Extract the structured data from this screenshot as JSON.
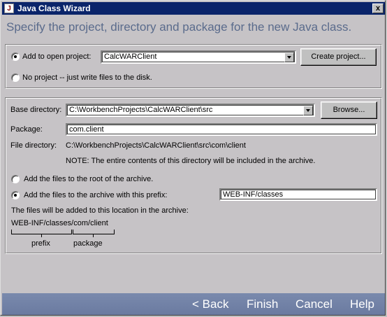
{
  "window": {
    "title": "Java Class Wizard",
    "close_label": "x"
  },
  "heading": "Specify the project, directory and package for the new Java class.",
  "project": {
    "add_label": "Add to open project:",
    "project_value": "CalcWARClient",
    "create_button": "Create project...",
    "no_project_label": "No project -- just write files to the disk."
  },
  "location": {
    "base_dir_label": "Base directory:",
    "base_dir_value": "C:\\WorkbenchProjects\\CalcWARClient\\src",
    "browse_button": "Browse...",
    "package_label": "Package:",
    "package_value": "com.client",
    "file_dir_label": "File directory:",
    "file_dir_value": "C:\\WorkbenchProjects\\CalcWARClient\\src\\com\\client",
    "note": "NOTE: The entire contents of this directory will be included in the archive.",
    "root_label": "Add the files to the root of the archive.",
    "prefix_label": "Add the files to the archive with this prefix:",
    "prefix_value": "WEB-INF/classes",
    "location_text": "The files will be added to this location in the archive:",
    "path_example": "WEB-INF/classes/com/client",
    "prefix_caption": "prefix",
    "package_caption": "package"
  },
  "nav": {
    "back": "< Back",
    "finish": "Finish",
    "cancel": "Cancel",
    "help": "Help"
  }
}
